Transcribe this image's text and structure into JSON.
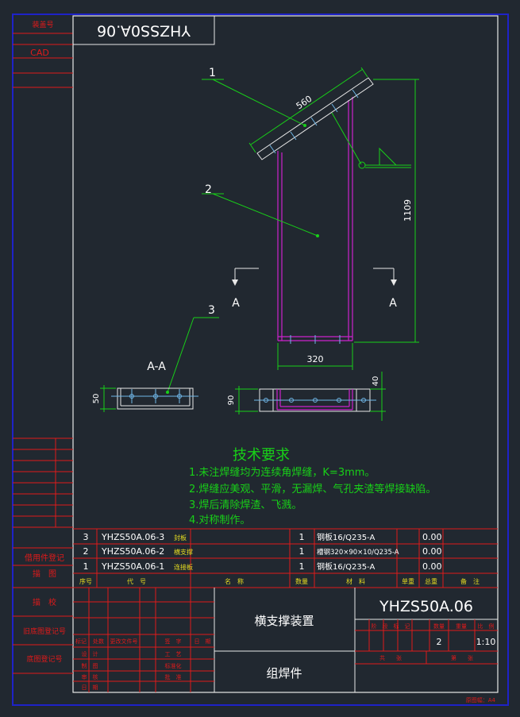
{
  "colors": {
    "background": "#212830",
    "frame_outer": "#1e22c8",
    "frame_inner": "#e8e8e8",
    "red": "#e01a1a",
    "part": "#cc22cc",
    "dim": "#18d018",
    "center": "#6fb7e8",
    "yellow": "#e6dd20",
    "white": "#ffffff"
  },
  "top_code_box": {
    "mirrored_text": "YHZSS0A.06"
  },
  "left_strip": {
    "top_labels": [
      "装盖号",
      "CAD"
    ],
    "bottom_labels": [
      "借用件登记",
      "描　图",
      "描　校",
      "旧底图登记号",
      "底图登记号"
    ]
  },
  "drawing": {
    "balloons": [
      "1",
      "2",
      "3"
    ],
    "dim_length": "560",
    "dim_height": "1109",
    "dim_width": "320",
    "section_marks": [
      "A",
      "A"
    ],
    "section_title": "A-A",
    "dim_section_small": "50",
    "dim_section_large": "90",
    "dim_end": "40"
  },
  "tech_req": {
    "title": "技术要求",
    "lines": [
      "1.未注焊缝均为连续角焊缝，K=3mm。",
      "2.焊缝应美观、平滑，无漏焊、气孔夹渣等焊接缺陷。",
      "3.焊后清除焊渣、飞溅。",
      "4.对称制作。"
    ]
  },
  "bom": {
    "rows": [
      {
        "no": "3",
        "code": "YHZS50A.06-3",
        "name": "封板",
        "qty": "1",
        "material": "钢板16/Q235-A",
        "unit_weight": "0.00"
      },
      {
        "no": "2",
        "code": "YHZS50A.06-2",
        "name": "横支撑",
        "qty": "1",
        "material": "槽钢320×90×10/Q235-A",
        "unit_weight": "0.00"
      },
      {
        "no": "1",
        "code": "YHZS50A.06-1",
        "name": "连接板",
        "qty": "1",
        "material": "钢板16/Q235-A",
        "unit_weight": "0.00"
      }
    ],
    "headers": [
      "序号",
      "代　号",
      "名　称",
      "数量",
      "材　料",
      "单重",
      "总重",
      "备　注"
    ]
  },
  "title_block": {
    "drawing_no": "YHZS50A.06",
    "name_top": "横支撑装置",
    "name_bottom": "组焊件",
    "stage_headers": [
      "阶　段　标　记",
      "数量",
      "重量",
      "比　例"
    ],
    "qty": "2",
    "scale": "1:10",
    "sheet_labels": [
      "共　　张",
      "第　　张"
    ],
    "rev_headers": [
      "标记",
      "处数",
      "更改文件号",
      "签　字",
      "日　期"
    ],
    "sign_left": [
      "设　计",
      "制　图",
      "审　核",
      "日　期"
    ],
    "sign_right": [
      "工　艺",
      "标准化",
      "批　准"
    ],
    "paper_size": "原图幅：A4"
  }
}
